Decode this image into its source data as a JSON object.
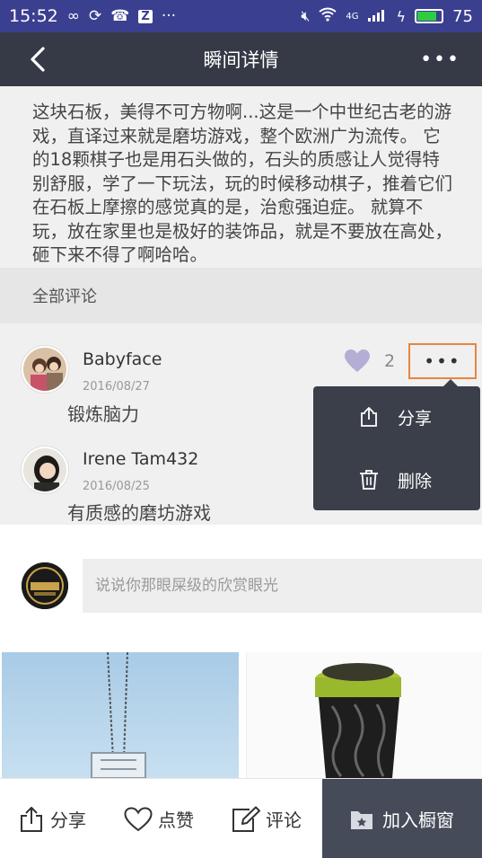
{
  "status_bar": {
    "time": "15:52",
    "icons": [
      "infinity-icon",
      "sync-icon",
      "missed-call-icon",
      "z-app-icon"
    ],
    "more": "···",
    "network": "4G",
    "battery": "75",
    "battery_fraction": 0.75
  },
  "header": {
    "title": "瞬间详情",
    "more": "•••"
  },
  "post": {
    "description": "这块石板，美得不可方物啊...这是一个中世纪古老的游戏，直译过来就是磨坊游戏，整个欧洲广为流传。 它的18颗棋子也是用石头做的，石头的质感让人觉得特别舒服，学了一下玩法，玩的时候移动棋子，推着它们在石板上摩擦的感觉真的是，治愈强迫症。 就算不玩，放在家里也是极好的装饰品，就是不要放在高处，砸下来不得了啊哈哈。"
  },
  "comments_section": {
    "title": "全部评论",
    "comments": [
      {
        "name": "Babyface",
        "date": "2016/08/27",
        "text": "锻炼脑力",
        "likes": "2"
      },
      {
        "name": "Irene Tam432",
        "date": "2016/08/25",
        "text": "有质感的磨坊游戏"
      }
    ],
    "more_button": "•••"
  },
  "popup_menu": {
    "items": [
      {
        "label": "分享",
        "icon": "share-icon"
      },
      {
        "label": "删除",
        "icon": "trash-icon"
      }
    ]
  },
  "comment_input": {
    "placeholder": "说说你那眼屎级的欣赏眼光"
  },
  "bottom_bar": {
    "share": "分享",
    "like": "点赞",
    "comment": "评论",
    "add_window": "加入橱窗"
  },
  "colors": {
    "status_bar": "#3b3f8f",
    "nav_bar": "#363a46",
    "popup": "#3a3f4a",
    "highlight_border": "#e8853d",
    "add_button": "#454b59"
  }
}
